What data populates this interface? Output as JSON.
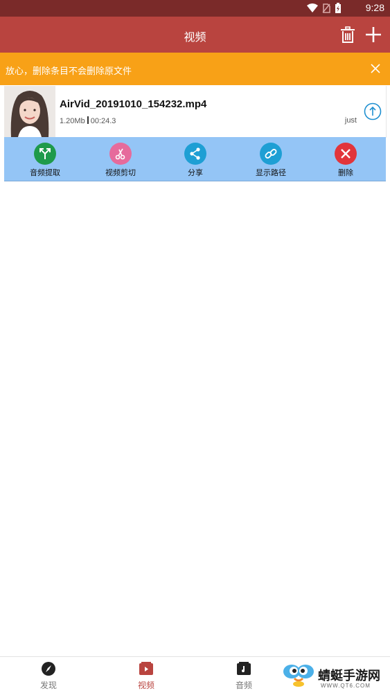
{
  "status_bar": {
    "time": "9:28"
  },
  "app_bar": {
    "title": "视频",
    "icons": [
      "trash-icon",
      "plus-icon"
    ]
  },
  "banner": {
    "text": "放心，删除条目不会删除原文件",
    "close_icon": "close-icon",
    "color": "#f8a117"
  },
  "file": {
    "name": "AirVid_20191010_154232.mp4",
    "size": "1.20Mb",
    "duration": "00:24.3",
    "time": "just",
    "upload_icon": "arrow-up-circle-icon"
  },
  "actions": [
    {
      "label": "音频提取",
      "icon": "merge-arrows-icon",
      "color": "#1f9a4b"
    },
    {
      "label": "视频剪切",
      "icon": "scissors-icon",
      "color": "#e66b9c"
    },
    {
      "label": "分享",
      "icon": "share-icon",
      "color": "#1e9fd4"
    },
    {
      "label": "显示路径",
      "icon": "link-icon",
      "color": "#1e9fd4"
    },
    {
      "label": "删除",
      "icon": "x-circle-icon",
      "color": "#e2353b"
    }
  ],
  "bottom_nav": [
    {
      "label": "发现",
      "icon": "compass-icon",
      "active": false
    },
    {
      "label": "视频",
      "icon": "video-icon",
      "active": true
    },
    {
      "label": "音频",
      "icon": "music-icon",
      "active": false
    },
    {
      "label": "",
      "icon": "more-icon",
      "active": false
    }
  ],
  "watermark": {
    "text": "蜻蜓手游网",
    "url": "WWW.QT6.COM"
  },
  "colors": {
    "app_bar": "#b9443f",
    "status_bar": "#7a2a29",
    "action_bar": "#94c5f6"
  }
}
